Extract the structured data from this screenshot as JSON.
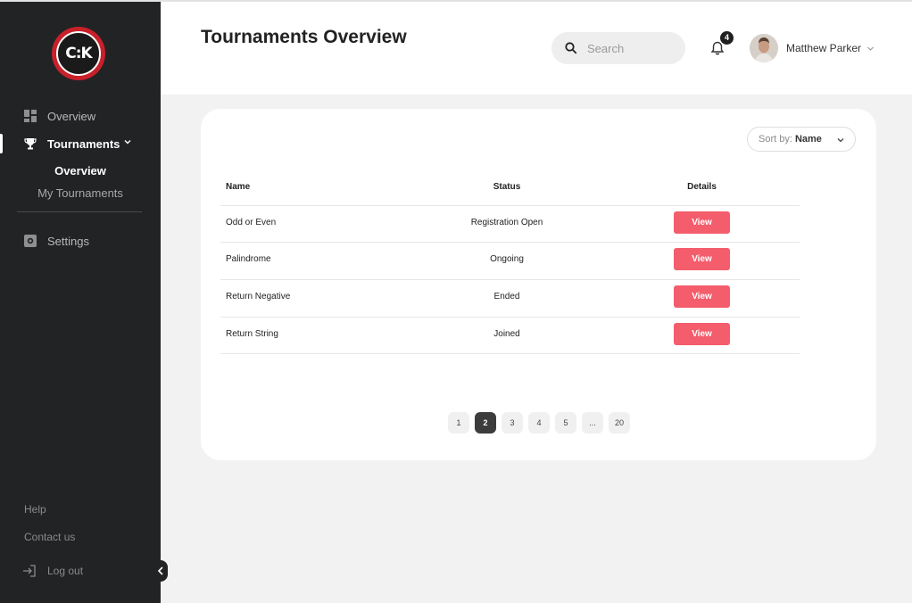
{
  "brand": {
    "logo_text": "C:K",
    "accent": "#c8202a"
  },
  "sidebar": {
    "items": [
      {
        "label": "Overview",
        "icon": "dashboard-icon"
      },
      {
        "label": "Tournaments",
        "icon": "trophy-icon",
        "active": true,
        "children": [
          {
            "label": "Overview",
            "active": true
          },
          {
            "label": "My Tournaments"
          }
        ]
      },
      {
        "label": "Settings",
        "icon": "settings-icon"
      }
    ],
    "footer": {
      "help": "Help",
      "contact": "Contact us",
      "logout": "Log out"
    }
  },
  "header": {
    "title": "Tournaments Overview",
    "search_placeholder": "Search",
    "notification_count": "4",
    "user_name": "Matthew Parker"
  },
  "card": {
    "sort_prefix": "Sort by:",
    "sort_value": "Name",
    "columns": [
      "Name",
      "Status",
      "Details"
    ],
    "rows": [
      {
        "name": "Odd or Even",
        "status": "Registration Open",
        "action": "View"
      },
      {
        "name": "Palindrome",
        "status": "Ongoing",
        "action": "View"
      },
      {
        "name": "Return Negative",
        "status": "Ended",
        "action": "View"
      },
      {
        "name": "Return String",
        "status": "Joined",
        "action": "View"
      }
    ],
    "pagination": {
      "pages": [
        "1",
        "2",
        "3",
        "4",
        "5",
        "...",
        "20"
      ],
      "current": "2"
    }
  },
  "colors": {
    "button": "#f45d6c",
    "sidebar_bg": "#222324",
    "page_bg": "#f2f2f2"
  }
}
